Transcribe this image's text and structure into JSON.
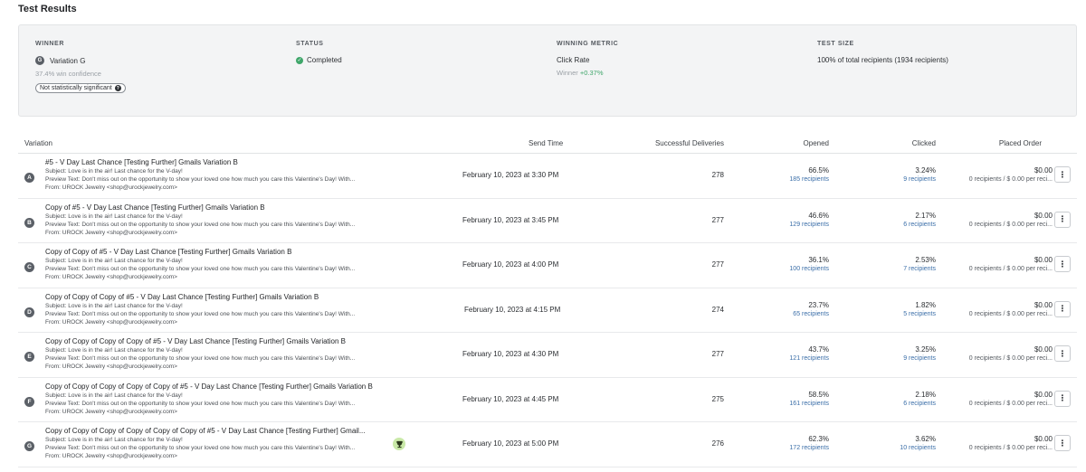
{
  "page_title": "Test Results",
  "summary": {
    "winner": {
      "label": "WINNER",
      "badge": "G",
      "value": "Variation G",
      "confidence": "37.4% win confidence",
      "pill": "Not statistically significant",
      "pill_icon": "?"
    },
    "status": {
      "label": "STATUS",
      "value": "Completed",
      "icon": "check-circle"
    },
    "metric": {
      "label": "WINNING METRIC",
      "value": "Click Rate",
      "winner_prefix": "Winner",
      "winner_delta": "+0.37%"
    },
    "test_size": {
      "label": "TEST SIZE",
      "value": "100% of total recipients (1934 recipients)"
    }
  },
  "table": {
    "headers": {
      "variation": "Variation",
      "send_time": "Send Time",
      "deliveries": "Successful Deliveries",
      "opened": "Opened",
      "clicked": "Clicked",
      "placed": "Placed Order"
    },
    "rows": [
      {
        "letter": "A",
        "name": "#5 - V Day Last Chance [Testing Further] Gmails Variation B",
        "subject": "Subject: Love is in the air! Last chance for the V-day!",
        "preview": "Preview Text: Don't miss out on the opportunity to show your loved one how much you care this Valentine's Day! With...",
        "from": "From: UROCK Jewelry <shop@urockjewelry.com>",
        "send_time": "February 10, 2023 at 3:30 PM",
        "deliveries": "278",
        "opened_pct": "66.5%",
        "opened_recipients": "185 recipients",
        "clicked_pct": "3.24%",
        "clicked_recipients": "9 recipients",
        "placed_val": "$0.00",
        "placed_sub": "0 recipients / $ 0.00 per reci...",
        "trophy": false
      },
      {
        "letter": "B",
        "name": "Copy of #5 - V Day Last Chance [Testing Further] Gmails Variation B",
        "subject": "Subject: Love is in the air! Last chance for the V-day!",
        "preview": "Preview Text: Don't miss out on the opportunity to show your loved one how much you care this Valentine's Day! With...",
        "from": "From: UROCK Jewelry <shop@urockjewelry.com>",
        "send_time": "February 10, 2023 at 3:45 PM",
        "deliveries": "277",
        "opened_pct": "46.6%",
        "opened_recipients": "129 recipients",
        "clicked_pct": "2.17%",
        "clicked_recipients": "6 recipients",
        "placed_val": "$0.00",
        "placed_sub": "0 recipients / $ 0.00 per reci...",
        "trophy": false
      },
      {
        "letter": "C",
        "name": "Copy of Copy of #5 - V Day Last Chance [Testing Further] Gmails Variation B",
        "subject": "Subject: Love is in the air! Last chance for the V-day!",
        "preview": "Preview Text: Don't miss out on the opportunity to show your loved one how much you care this Valentine's Day! With...",
        "from": "From: UROCK Jewelry <shop@urockjewelry.com>",
        "send_time": "February 10, 2023 at 4:00 PM",
        "deliveries": "277",
        "opened_pct": "36.1%",
        "opened_recipients": "100 recipients",
        "clicked_pct": "2.53%",
        "clicked_recipients": "7 recipients",
        "placed_val": "$0.00",
        "placed_sub": "0 recipients / $ 0.00 per reci...",
        "trophy": false
      },
      {
        "letter": "D",
        "name": "Copy of Copy of Copy of #5 - V Day Last Chance [Testing Further] Gmails Variation B",
        "subject": "Subject: Love is in the air! Last chance for the V-day!",
        "preview": "Preview Text: Don't miss out on the opportunity to show your loved one how much you care this Valentine's Day! With...",
        "from": "From: UROCK Jewelry <shop@urockjewelry.com>",
        "send_time": "February 10, 2023 at 4:15 PM",
        "deliveries": "274",
        "opened_pct": "23.7%",
        "opened_recipients": "65 recipients",
        "clicked_pct": "1.82%",
        "clicked_recipients": "5 recipients",
        "placed_val": "$0.00",
        "placed_sub": "0 recipients / $ 0.00 per reci...",
        "trophy": false
      },
      {
        "letter": "E",
        "name": "Copy of Copy of Copy of Copy of #5 - V Day Last Chance [Testing Further] Gmails Variation B",
        "subject": "Subject: Love is in the air! Last chance for the V-day!",
        "preview": "Preview Text: Don't miss out on the opportunity to show your loved one how much you care this Valentine's Day! With...",
        "from": "From: UROCK Jewelry <shop@urockjewelry.com>",
        "send_time": "February 10, 2023 at 4:30 PM",
        "deliveries": "277",
        "opened_pct": "43.7%",
        "opened_recipients": "121 recipients",
        "clicked_pct": "3.25%",
        "clicked_recipients": "9 recipients",
        "placed_val": "$0.00",
        "placed_sub": "0 recipients / $ 0.00 per reci...",
        "trophy": false
      },
      {
        "letter": "F",
        "name": "Copy of Copy of Copy of Copy of Copy of #5 - V Day Last Chance [Testing Further] Gmails Variation B",
        "subject": "Subject: Love is in the air! Last chance for the V-day!",
        "preview": "Preview Text: Don't miss out on the opportunity to show your loved one how much you care this Valentine's Day! With...",
        "from": "From: UROCK Jewelry <shop@urockjewelry.com>",
        "send_time": "February 10, 2023 at 4:45 PM",
        "deliveries": "275",
        "opened_pct": "58.5%",
        "opened_recipients": "161 recipients",
        "clicked_pct": "2.18%",
        "clicked_recipients": "6 recipients",
        "placed_val": "$0.00",
        "placed_sub": "0 recipients / $ 0.00 per reci...",
        "trophy": false
      },
      {
        "letter": "G",
        "name": "Copy of Copy of Copy of Copy of Copy of Copy of #5 - V Day Last Chance [Testing Further] Gmail...",
        "subject": "Subject: Love is in the air! Last chance for the V-day!",
        "preview": "Preview Text: Don't miss out on the opportunity to show your loved one how much you care this Valentine's Day! With...",
        "from": "From: UROCK Jewelry <shop@urockjewelry.com>",
        "send_time": "February 10, 2023 at 5:00 PM",
        "deliveries": "276",
        "opened_pct": "62.3%",
        "opened_recipients": "172 recipients",
        "clicked_pct": "3.62%",
        "clicked_recipients": "10 recipients",
        "placed_val": "$0.00",
        "placed_sub": "0 recipients / $ 0.00 per reci...",
        "trophy": true
      }
    ]
  },
  "colors": {
    "accent_link": "#3a6ea8",
    "success": "#3fa66a",
    "trophy_bg": "#c9e9a8"
  }
}
